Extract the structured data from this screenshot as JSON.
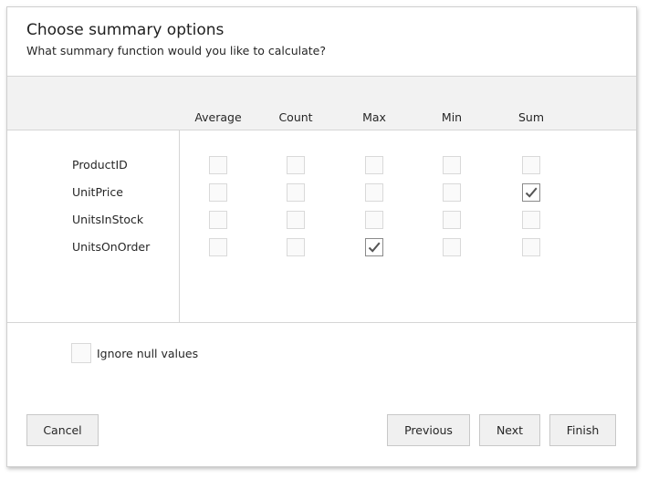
{
  "header": {
    "title": "Choose summary options",
    "subtitle": "What summary function would you like to calculate?"
  },
  "grid": {
    "columns": [
      "Average",
      "Count",
      "Max",
      "Min",
      "Sum"
    ],
    "rows": [
      {
        "field": "ProductID",
        "checks": [
          false,
          false,
          false,
          false,
          false
        ]
      },
      {
        "field": "UnitPrice",
        "checks": [
          false,
          false,
          false,
          false,
          true
        ]
      },
      {
        "field": "UnitsInStock",
        "checks": [
          false,
          false,
          false,
          false,
          false
        ]
      },
      {
        "field": "UnitsOnOrder",
        "checks": [
          false,
          false,
          true,
          false,
          false
        ]
      }
    ]
  },
  "options": {
    "ignore_nulls_label": "Ignore null values",
    "ignore_nulls_checked": false
  },
  "buttons": {
    "cancel": "Cancel",
    "previous": "Previous",
    "next": "Next",
    "finish": "Finish"
  },
  "icons": {
    "check": "check-icon"
  }
}
